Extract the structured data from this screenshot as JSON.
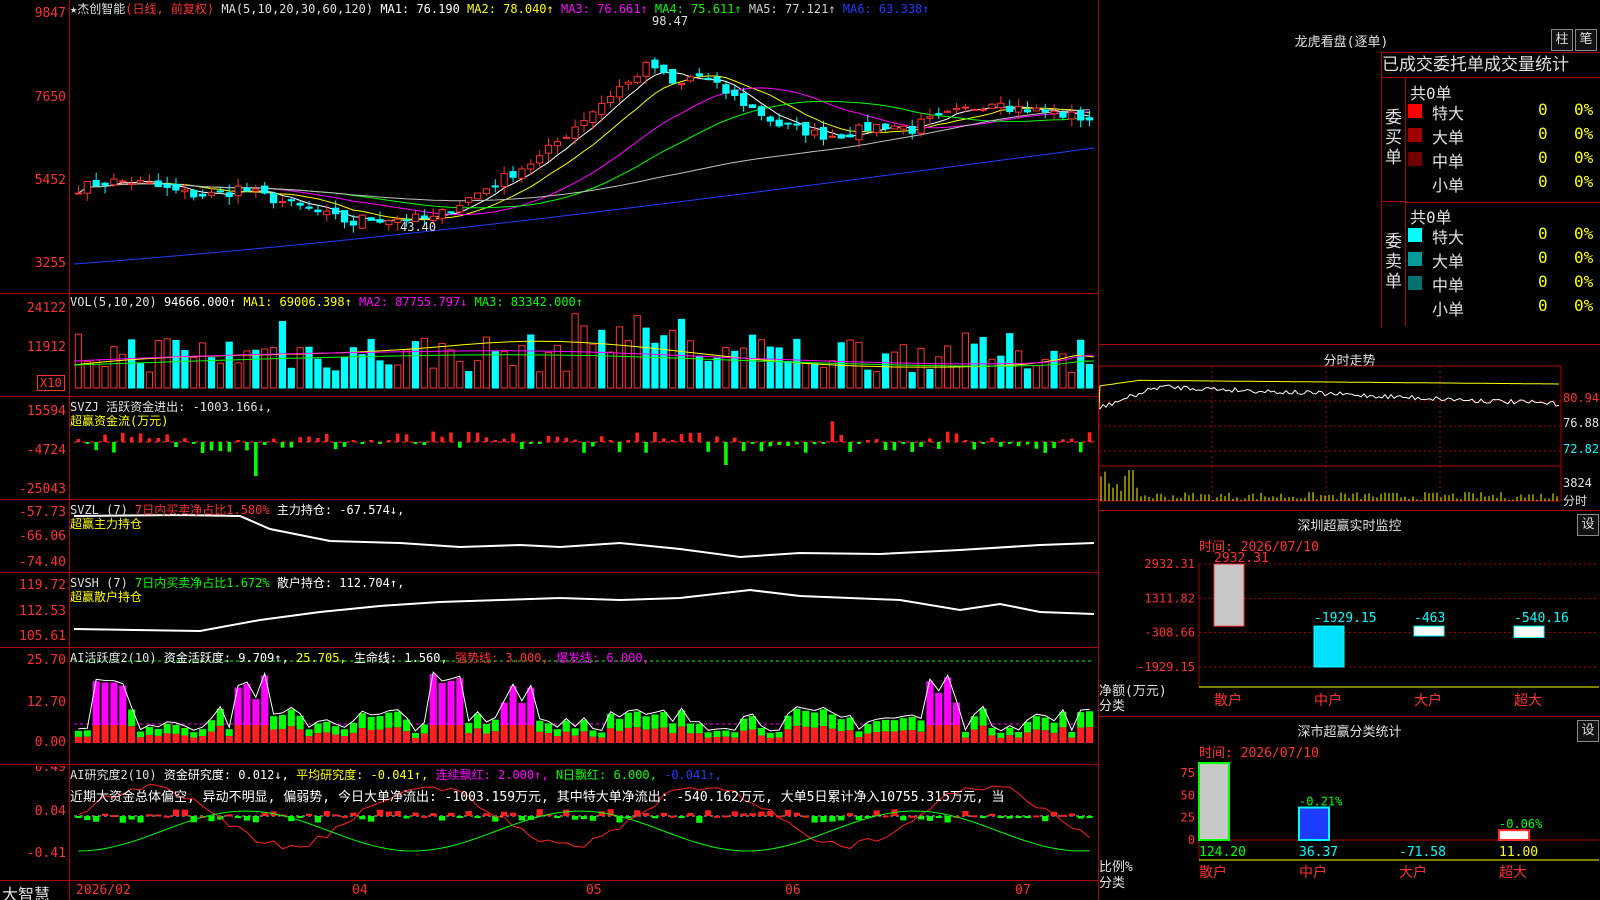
{
  "main": {
    "stock_title": "★杰创智能",
    "mode": "(日线, 前复权)",
    "ma_header": "MA(5,10,20,30,60,120)",
    "ma1": "MA1: 76.190",
    "ma2": "MA2: 78.040↑",
    "ma3": "MA3: 76.661↑",
    "ma4": "MA4: 75.611↑",
    "ma5": "MA5: 77.121↑",
    "ma6": "MA6: 63.338↑",
    "high_label": "98.47",
    "low_label": "43.40",
    "axis": [
      "9847",
      "7650",
      "5452",
      "3255"
    ]
  },
  "vol": {
    "label": "VOL(5,10,20)",
    "value": "94666.000↑",
    "ma1": "MA1: 69006.398↑",
    "ma2": "MA2: 87755.797↓",
    "ma3": "MA3: 83342.000↑",
    "axis": [
      "24122",
      "11912"
    ],
    "unit": "X10"
  },
  "svzj": {
    "label": "SVZJ  活跃资金进出: -1003.166↓,",
    "sub": "超赢资金流(万元)",
    "axis": [
      "15594",
      "-4724",
      "-25043"
    ]
  },
  "svzl": {
    "label": "SVZL (7)",
    "label2": "7日内买卖净占比1.580%",
    "label3": "主力持仓: -67.574↓,",
    "sub": "超赢主力持仓",
    "axis": [
      "-57.73",
      "-66.06",
      "-74.40"
    ]
  },
  "svsh": {
    "label": "SVSH (7)",
    "label2": "7日内买卖净占比1.672%",
    "label3": "散户持仓: 112.704↑,",
    "sub": "超赢散户持仓",
    "axis": [
      "119.72",
      "112.53",
      "105.61"
    ]
  },
  "ai1": {
    "label": "AI活跃度2(10)",
    "a": "资金活跃度: 9.709↑,",
    "b": "25.705,",
    "c": "生命线: 1.560,",
    "d": "强势线: 3.000,",
    "e": "爆发线: 6.000,",
    "axis": [
      "25.70",
      "12.70",
      "0.00"
    ]
  },
  "ai2": {
    "label": "AI研究度2(10)",
    "a": "资金研究度: 0.012↓,",
    "b": "平均研究度: -0.041↑,",
    "c": "连续飘红: 2.000↑,",
    "d": "N日飘红: 6.000,",
    "e": "-0.041↑,",
    "comment": "近期大资金总体偏空, 异动不明显, 偏弱势, 今日大单净流出: -1003.159万元, 其中特大单净流出: -540.162万元, 大单5日累计净入10755.315万元, 当",
    "axis": [
      "0.49",
      "0.04",
      "-0.41"
    ]
  },
  "bottom": {
    "brand": "大智慧",
    "dates": [
      "2026/02",
      "04",
      "05",
      "06",
      "07"
    ]
  },
  "right": {
    "lhb_title": "龙虎看盘(逐单)",
    "btn_col": "柱",
    "btn_note": "笔",
    "tabs": [
      "已成交",
      "委托单",
      "成交量统计"
    ],
    "buy_side": "委买单",
    "sell_side": "委卖单",
    "buy_total": "共0单",
    "sell_total": "共0单",
    "buy_rows": [
      {
        "name": "特大",
        "n": "0",
        "p": "0%",
        "color": "#ff0000"
      },
      {
        "name": "大单",
        "n": "0",
        "p": "0%",
        "color": "#a00000"
      },
      {
        "name": "中单",
        "n": "0",
        "p": "0%",
        "color": "#700000"
      },
      {
        "name": "小单",
        "n": "0",
        "p": "0%",
        "color": ""
      }
    ],
    "sell_rows": [
      {
        "name": "特大",
        "n": "0",
        "p": "0%",
        "color": "#00ffff"
      },
      {
        "name": "大单",
        "n": "0",
        "p": "0%",
        "color": "#009a9a"
      },
      {
        "name": "中单",
        "n": "0",
        "p": "0%",
        "color": "#007070"
      },
      {
        "name": "小单",
        "n": "0",
        "p": "0%",
        "color": ""
      }
    ],
    "fs_title": "分时走势",
    "fs_axis": [
      "80.94",
      "76.88",
      "72.82",
      "3824",
      "分时"
    ],
    "sz_title": "深圳超赢实时监控",
    "sz_set": "设",
    "sz_time": "时间: 2026/07/10",
    "sz_axis": [
      "2932.31",
      "1311.82",
      "-308.66",
      "-1929.15"
    ],
    "sz_ylabel1": "净额(万元)",
    "sz_ylabel2": "分类",
    "sz_cats": [
      "散户",
      "中户",
      "大户",
      "超大"
    ],
    "sz_vals": [
      "2932.31",
      "-1929.15",
      "-463",
      "-540.16"
    ],
    "ss_title": "深市超赢分类统计",
    "ss_set": "设",
    "ss_time": "时间: 2026/07/10",
    "ss_axis": [
      "75",
      "50",
      "25",
      "0"
    ],
    "ss_ylabel1": "比例%",
    "ss_ylabel2": "分类",
    "ss_top": [
      "",
      "-0.21%",
      "",
      "-0.06%"
    ],
    "ss_bottom": [
      "124.20",
      "36.37",
      "-71.58",
      "11.00"
    ],
    "ss_cats": [
      "散户",
      "中户",
      "大户",
      "超大"
    ]
  },
  "chart_data": [
    {
      "type": "bar",
      "title": "深圳超赢实时监控",
      "categories": [
        "散户",
        "中户",
        "大户",
        "超大"
      ],
      "values": [
        2932.31,
        -1929.15,
        -463,
        -540.16
      ],
      "ylim": [
        -1929.15,
        2932.31
      ]
    },
    {
      "type": "bar",
      "title": "深市超赢分类统计",
      "categories": [
        "散户",
        "中户",
        "大户",
        "超大"
      ],
      "values": [
        124.2,
        36.37,
        -71.58,
        11.0
      ],
      "ylim": [
        0,
        75
      ]
    }
  ]
}
